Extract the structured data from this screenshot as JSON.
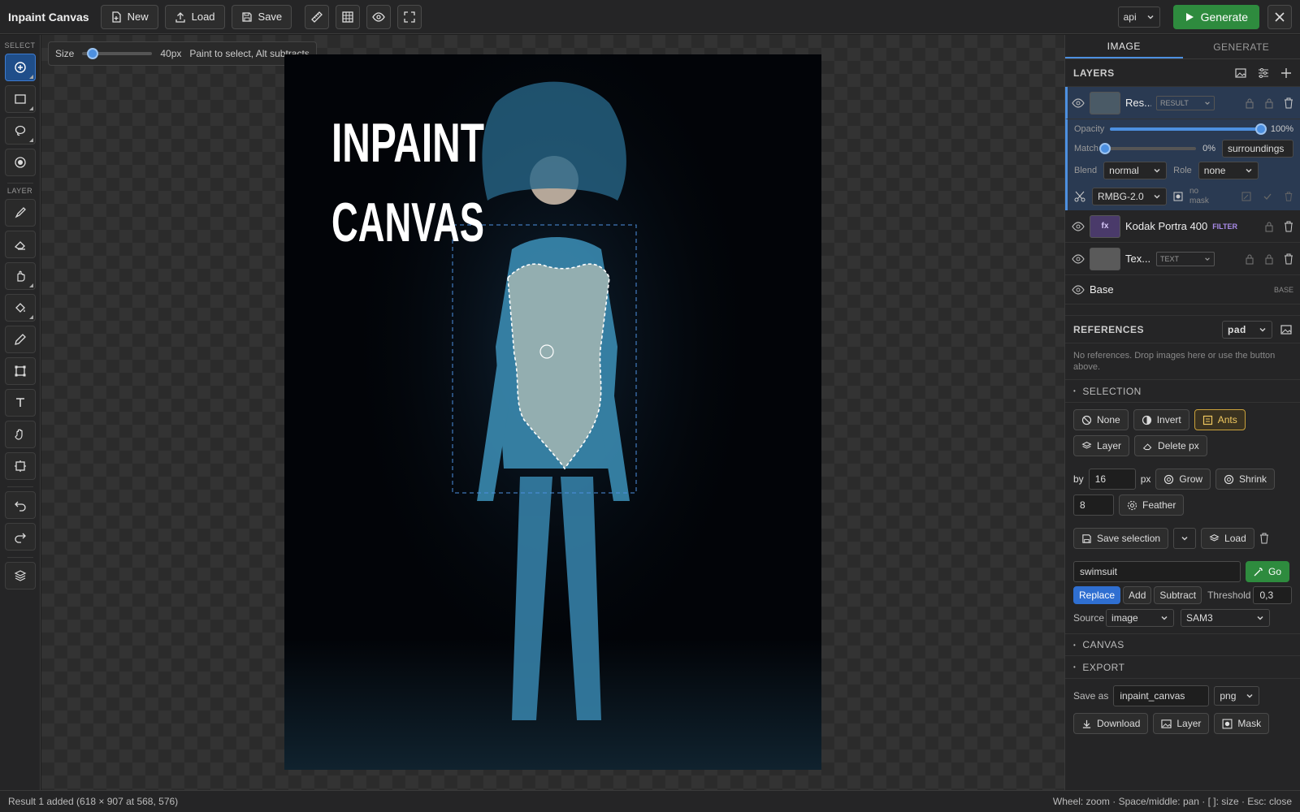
{
  "app": {
    "title": "Inpaint Canvas"
  },
  "toolbar": {
    "new_label": "New",
    "load_label": "Load",
    "save_label": "Save",
    "backend": "api",
    "generate_label": "Generate"
  },
  "left_toolbar": {
    "select_label": "SELECT",
    "layer_label": "LAYER"
  },
  "brush_popup": {
    "size_label": "Size",
    "size_value": "40px",
    "size_level": 0.08,
    "hint": "Paint to select, Alt subtracts"
  },
  "canvas_image": {
    "title_line1": "INPAINT",
    "title_line2": "CANVAS"
  },
  "right_panel": {
    "tabs": [
      "IMAGE",
      "GENERATE"
    ],
    "layers_title": "LAYERS",
    "layers": [
      {
        "name": "Res...",
        "tag": "RESULT"
      },
      {
        "name": "Kodak Portra 400",
        "tag": "FILTER",
        "thumb": "fx"
      },
      {
        "name": "Tex...",
        "tag": "TEXT"
      },
      {
        "name": "Base",
        "tag": "BASE"
      }
    ],
    "opacity": {
      "label": "Opacity",
      "value": "100%",
      "level": 1.0
    },
    "match": {
      "label": "Match",
      "value": "0%",
      "level": 0.0,
      "mode": "surroundings"
    },
    "blend": {
      "label": "Blend",
      "value": "normal"
    },
    "role": {
      "label": "Role",
      "value": "none"
    },
    "bg_model": "RMBG-2.0",
    "mask_status": "no mask",
    "references": {
      "title": "REFERENCES",
      "mode": "pad",
      "empty_text": "No references. Drop images here or use the button above."
    },
    "selection": {
      "title": "SELECTION",
      "none_label": "None",
      "invert_label": "Invert",
      "ants_label": "Ants",
      "layer_label": "Layer",
      "delete_px_label": "Delete px",
      "by_label": "by",
      "by_value": "16",
      "px_label": "px",
      "grow_label": "Grow",
      "shrink_label": "Shrink",
      "feather_value": "8",
      "feather_label": "Feather",
      "save_selection_label": "Save selection",
      "load_label": "Load",
      "prompt_value": "swimsuit",
      "go_label": "Go",
      "replace_label": "Replace",
      "add_label": "Add",
      "subtract_label": "Subtract",
      "threshold_label": "Threshold",
      "threshold_value": "0,3",
      "source_label": "Source",
      "source_value": "image",
      "model_value": "SAM3"
    },
    "canvas_title": "CANVAS",
    "export": {
      "title": "EXPORT",
      "save_as_label": "Save as",
      "filename": "inpaint_canvas",
      "format": "png",
      "download_label": "Download",
      "layer_label": "Layer",
      "mask_label": "Mask"
    }
  },
  "status": {
    "left": "Result 1 added (618 × 907 at 568, 576)",
    "right": "Wheel: zoom · Space/middle: pan · [ ]: size · Esc: close"
  }
}
